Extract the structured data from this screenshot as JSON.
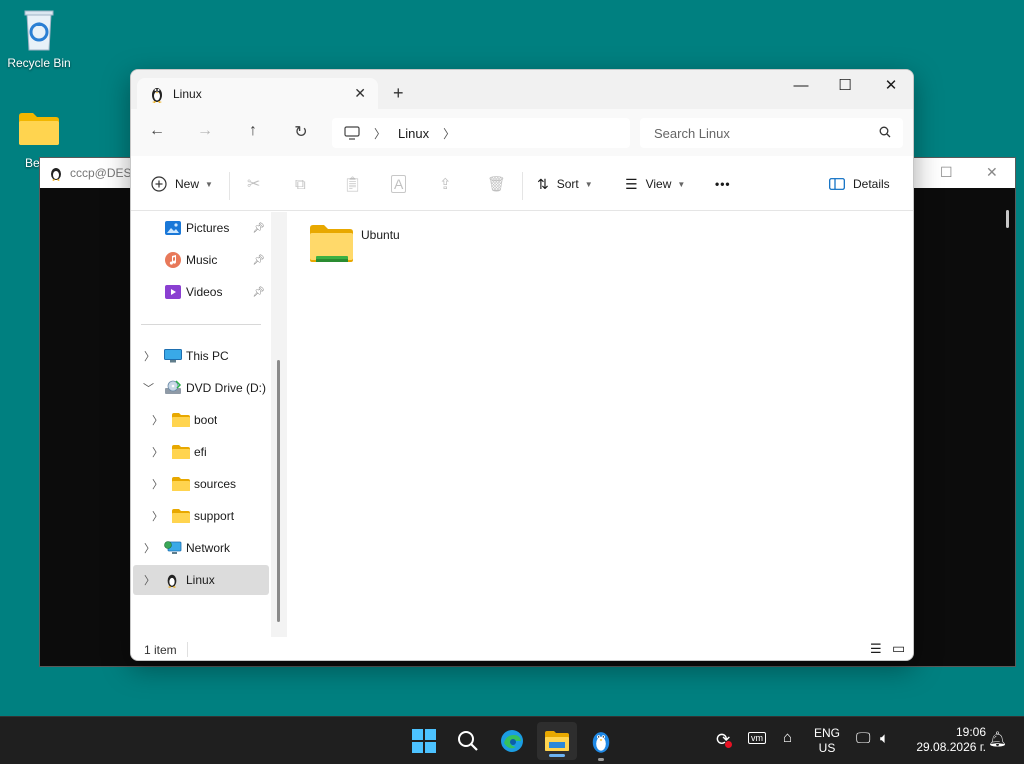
{
  "desktop": {
    "icons": [
      {
        "label": "Recycle Bin"
      },
      {
        "label": "Be"
      }
    ]
  },
  "terminal": {
    "title": "cccp@DESK"
  },
  "explorer": {
    "tab": {
      "title": "Linux"
    },
    "address": {
      "crumbs": [
        "Linux"
      ]
    },
    "search": {
      "placeholder": "Search Linux"
    },
    "commands": {
      "new": "New",
      "sort": "Sort",
      "view": "View",
      "more": "•••",
      "details": "Details"
    },
    "sidebar": {
      "quick_access": [
        {
          "label": "Pictures"
        },
        {
          "label": "Music"
        },
        {
          "label": "Videos"
        }
      ],
      "tree": [
        {
          "label": "This PC"
        },
        {
          "label": "DVD Drive (D:) C"
        },
        {
          "label": "boot"
        },
        {
          "label": "efi"
        },
        {
          "label": "sources"
        },
        {
          "label": "support"
        },
        {
          "label": "Network"
        },
        {
          "label": "Linux"
        }
      ]
    },
    "content": {
      "items": [
        {
          "name": "Ubuntu"
        }
      ]
    },
    "status": {
      "count": "1 item"
    }
  },
  "taskbar": {
    "language": [
      "ENG",
      "US"
    ],
    "time": "19:06",
    "date": "29.08.2026 г."
  },
  "colors": {
    "desktop": "#008080",
    "taskbar": "#1f1f1f",
    "folder": "#f7c842",
    "accent": "#0078d4"
  }
}
